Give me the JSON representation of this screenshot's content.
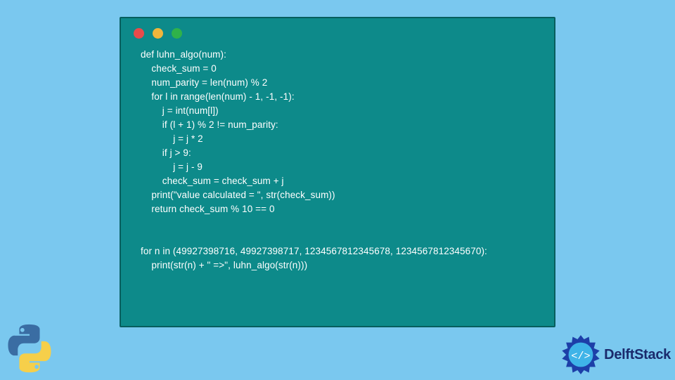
{
  "code": {
    "lines": [
      "def luhn_algo(num):",
      "    check_sum = 0",
      "    num_parity = len(num) % 2",
      "    for l in range(len(num) - 1, -1, -1):",
      "        j = int(num[l])",
      "        if (l + 1) % 2 != num_parity:",
      "            j = j * 2",
      "        if j > 9:",
      "            j = j - 9",
      "        check_sum = check_sum + j",
      "    print(\"value calculated = \", str(check_sum))",
      "    return check_sum % 10 == 0",
      "",
      "",
      "for n in (49927398716, 49927398717, 1234567812345678, 1234567812345670):",
      "    print(str(n) + \" =>\", luhn_algo(str(n)))"
    ]
  },
  "branding": {
    "site_name": "DelftStack"
  },
  "window": {
    "dots": [
      "red",
      "yellow",
      "green"
    ]
  }
}
